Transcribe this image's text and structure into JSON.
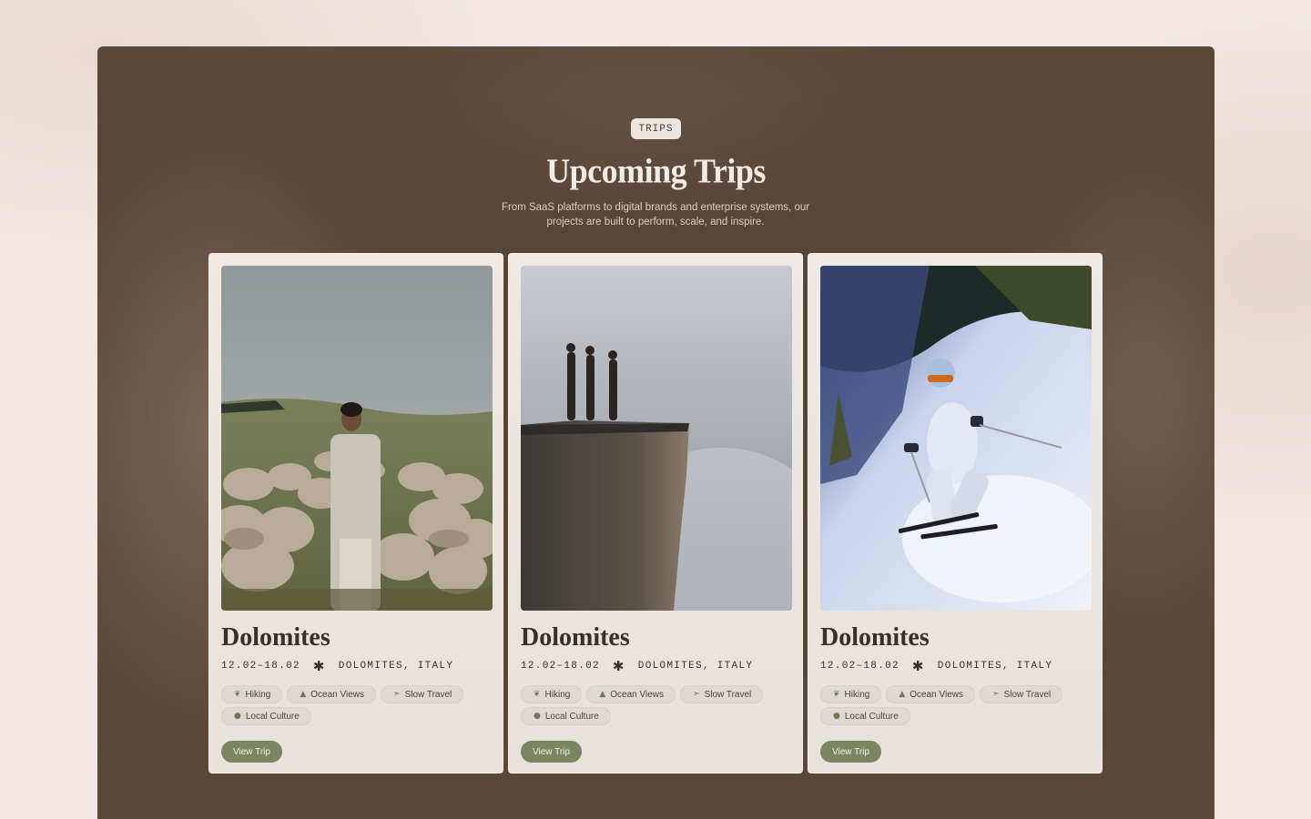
{
  "section": {
    "eyebrow": "TRIPS",
    "title": "Upcoming Trips",
    "subtitle": "From SaaS platforms to digital brands and enterprise systems, our projects are built to perform, scale, and inspire."
  },
  "cards": [
    {
      "name": "Dolomites",
      "dates": "12.02–18.02",
      "separator": "✱",
      "location": "DOLOMITES, ITALY",
      "image": "woman-with-sheep-photo",
      "tags": [
        {
          "icon": "sprout-icon",
          "label": "Hiking"
        },
        {
          "icon": "mountain-icon",
          "label": "Ocean Views"
        },
        {
          "icon": "leaf-icon",
          "label": "Slow Travel"
        },
        {
          "icon": "globe-icon",
          "label": "Local Culture"
        }
      ],
      "button": "View Trip"
    },
    {
      "name": "Dolomites",
      "dates": "12.02–18.02",
      "separator": "✱",
      "location": "DOLOMITES, ITALY",
      "image": "cliff-edge-photo",
      "tags": [
        {
          "icon": "sprout-icon",
          "label": "Hiking"
        },
        {
          "icon": "mountain-icon",
          "label": "Ocean Views"
        },
        {
          "icon": "leaf-icon",
          "label": "Slow Travel"
        },
        {
          "icon": "globe-icon",
          "label": "Local Culture"
        }
      ],
      "button": "View Trip"
    },
    {
      "name": "Dolomites",
      "dates": "12.02–18.02",
      "separator": "✱",
      "location": "DOLOMITES, ITALY",
      "image": "skier-photo",
      "tags": [
        {
          "icon": "sprout-icon",
          "label": "Hiking"
        },
        {
          "icon": "mountain-icon",
          "label": "Ocean Views"
        },
        {
          "icon": "leaf-icon",
          "label": "Slow Travel"
        },
        {
          "icon": "globe-icon",
          "label": "Local Culture"
        }
      ],
      "button": "View Trip"
    }
  ],
  "colors": {
    "panel": "#574436",
    "card": "#efe9e4",
    "accent": "#7b8561"
  }
}
